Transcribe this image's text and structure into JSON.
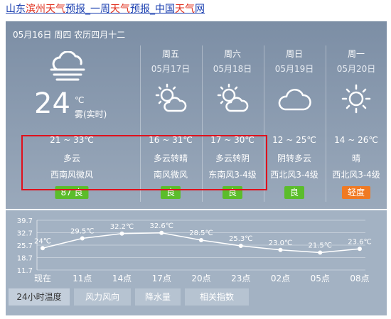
{
  "page_title": {
    "parts": [
      {
        "text": "山东",
        "highlight": false
      },
      {
        "text": "滨州天气",
        "highlight": true
      },
      {
        "text": "预报_一周",
        "highlight": false
      },
      {
        "text": "天气",
        "highlight": true
      },
      {
        "text": "预报_中国",
        "highlight": false
      },
      {
        "text": "天气",
        "highlight": true
      },
      {
        "text": "网",
        "highlight": false
      }
    ]
  },
  "today": {
    "date_line": "05月16日 周四 农历四月十二",
    "temp": "24",
    "unit": "℃",
    "note": "雾(实时)",
    "range": "21 ~ 33℃",
    "condition": "多云",
    "wind": "西南风微风",
    "aqi": "87 良",
    "aqi_color": "#5bbd2b",
    "icon": "cloud-fog-icon"
  },
  "forecast": [
    {
      "day": "周五",
      "date": "05月17日",
      "range": "16 ~ 31℃",
      "condition": "多云转晴",
      "wind": "南风微风",
      "aqi": "良",
      "aqi_color": "#5bbd2b",
      "icon": "partly-cloudy-icon"
    },
    {
      "day": "周六",
      "date": "05月18日",
      "range": "17 ~ 30℃",
      "condition": "多云转阴",
      "wind": "东南风3-4级",
      "aqi": "良",
      "aqi_color": "#5bbd2b",
      "icon": "partly-cloudy-icon"
    },
    {
      "day": "周日",
      "date": "05月19日",
      "range": "12 ~ 25℃",
      "condition": "阴转多云",
      "wind": "西北风3-4级",
      "aqi": "良",
      "aqi_color": "#5bbd2b",
      "icon": "cloud-icon"
    },
    {
      "day": "周一",
      "date": "05月20日",
      "range": "14 ~ 26℃",
      "condition": "晴",
      "wind": "西北风3-4级",
      "aqi": "轻度",
      "aqi_color": "#f07a23",
      "icon": "sun-icon"
    }
  ],
  "chart_data": {
    "type": "line",
    "categories": [
      "现在",
      "11点",
      "14点",
      "17点",
      "20点",
      "23点",
      "02点",
      "05点",
      "08点"
    ],
    "values": [
      24,
      29.5,
      32.2,
      32.6,
      28.5,
      25.3,
      23.0,
      21.5,
      23.6
    ],
    "value_labels": [
      "24℃",
      "29.5℃",
      "32.2℃",
      "32.6℃",
      "28.5℃",
      "25.3℃",
      "23.0℃",
      "21.5℃",
      "23.6℃"
    ],
    "y_ticks": [
      39.7,
      32.7,
      25.7,
      18.7,
      11.7
    ],
    "ylim": [
      11.7,
      39.7
    ],
    "grid": true
  },
  "tabs": [
    {
      "label": "24小时温度",
      "active": true
    },
    {
      "label": "风力风向",
      "active": false
    },
    {
      "label": "降水量",
      "active": false
    },
    {
      "label": "相关指数",
      "active": false
    }
  ]
}
